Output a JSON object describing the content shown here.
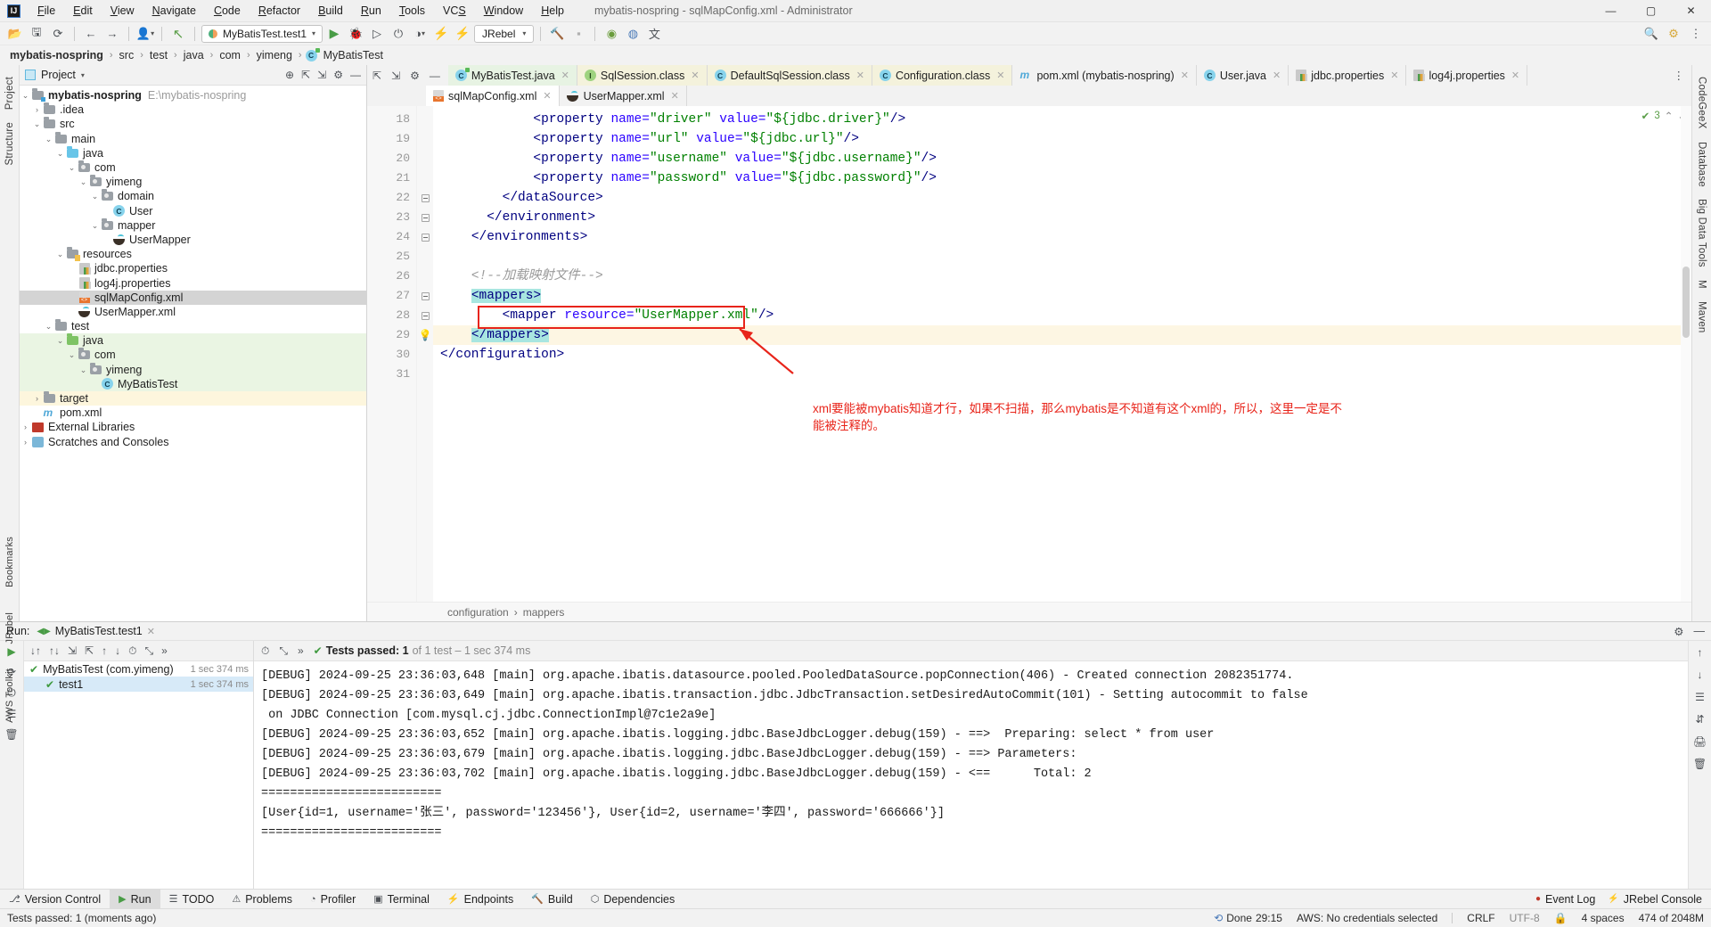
{
  "window": {
    "title": "mybatis-nospring - sqlMapConfig.xml - Administrator",
    "logo": "IJ",
    "minimize": "—",
    "maximize": "▢",
    "close": "✕"
  },
  "menubar": {
    "items": [
      "File",
      "Edit",
      "View",
      "Navigate",
      "Code",
      "Refactor",
      "Build",
      "Run",
      "Tools",
      "VCS",
      "Window",
      "Help"
    ]
  },
  "toolbar": {
    "open_icon": "📂",
    "save_icon": "🖫",
    "sync_icon": "⟳",
    "back_icon": "←",
    "forward_icon": "→",
    "profile_icon": "👤",
    "update_icon": "↖",
    "run_config": "MyBatisTest.test1",
    "run_icon": "▶",
    "debug_icon": "🐞",
    "coverage_icon": "▷",
    "profiler_icon": "◑",
    "stop_icon": "⏻",
    "jrebel_run_icon": "⚡",
    "jrebel_debug_icon": "⚡",
    "jrebel_label": "JRebel",
    "search_icon": "🔍",
    "settings_icon": "⚙",
    "more_icon": "⋮"
  },
  "breadcrumb": {
    "items": [
      "mybatis-nospring",
      "src",
      "test",
      "java",
      "com",
      "yimeng",
      "MyBatisTest"
    ],
    "separator": "›"
  },
  "left_rail": [
    "Project",
    "Structure"
  ],
  "right_rail": [
    "CodeGeeX",
    "Database",
    "Big Data Tools",
    "M",
    "Maven"
  ],
  "project_panel": {
    "title": "Project",
    "chevron": "▾",
    "locate_icon": "⊕",
    "collapse_icon": "⇲",
    "expand_icon": "⇱",
    "settings_icon": "⚙",
    "hide_icon": "—",
    "tree": [
      {
        "depth": 0,
        "arrow": "⌄",
        "icon": "folder-badge",
        "label": "mybatis-nospring",
        "bold": true,
        "path": "E:\\mybatis-nospring",
        "state": "normal"
      },
      {
        "depth": 1,
        "arrow": "›",
        "icon": "folder",
        "label": ".idea",
        "state": "normal"
      },
      {
        "depth": 1,
        "arrow": "⌄",
        "icon": "folder",
        "label": "src",
        "state": "normal"
      },
      {
        "depth": 2,
        "arrow": "⌄",
        "icon": "folder",
        "label": "main",
        "state": "normal"
      },
      {
        "depth": 3,
        "arrow": "⌄",
        "icon": "folder-blue",
        "label": "java",
        "state": "normal"
      },
      {
        "depth": 4,
        "arrow": "⌄",
        "icon": "folder-pkg",
        "label": "com",
        "state": "normal"
      },
      {
        "depth": 5,
        "arrow": "⌄",
        "icon": "folder-pkg",
        "label": "yimeng",
        "state": "normal"
      },
      {
        "depth": 6,
        "arrow": "⌄",
        "icon": "folder-pkg",
        "label": "domain",
        "state": "normal"
      },
      {
        "depth": 7,
        "arrow": "",
        "icon": "class",
        "label": "User",
        "state": "normal"
      },
      {
        "depth": 6,
        "arrow": "⌄",
        "icon": "folder-pkg",
        "label": "mapper",
        "state": "normal"
      },
      {
        "depth": 7,
        "arrow": "",
        "icon": "mapper",
        "label": "UserMapper",
        "state": "normal"
      },
      {
        "depth": 3,
        "arrow": "⌄",
        "icon": "folder-res",
        "label": "resources",
        "state": "normal"
      },
      {
        "depth": 4,
        "arrow": "",
        "icon": "properties",
        "label": "jdbc.properties",
        "state": "normal"
      },
      {
        "depth": 4,
        "arrow": "",
        "icon": "properties",
        "label": "log4j.properties",
        "state": "normal"
      },
      {
        "depth": 4,
        "arrow": "",
        "icon": "xml",
        "label": "sqlMapConfig.xml",
        "state": "selected"
      },
      {
        "depth": 4,
        "arrow": "",
        "icon": "mapper",
        "label": "UserMapper.xml",
        "state": "normal"
      },
      {
        "depth": 2,
        "arrow": "⌄",
        "icon": "folder",
        "label": "test",
        "state": "normal"
      },
      {
        "depth": 3,
        "arrow": "⌄",
        "icon": "folder-green",
        "label": "java",
        "state": "testsrc"
      },
      {
        "depth": 4,
        "arrow": "⌄",
        "icon": "folder-pkg",
        "label": "com",
        "state": "testsrc"
      },
      {
        "depth": 5,
        "arrow": "⌄",
        "icon": "folder-pkg",
        "label": "yimeng",
        "state": "testsrc"
      },
      {
        "depth": 6,
        "arrow": "",
        "icon": "class",
        "label": "MyBatisTest",
        "state": "testsrc"
      },
      {
        "depth": 1,
        "arrow": "›",
        "icon": "folder",
        "label": "target",
        "state": "target"
      },
      {
        "depth": 1,
        "arrow": "",
        "icon": "maven",
        "label": "pom.xml",
        "state": "normal"
      },
      {
        "depth": 0,
        "arrow": "›",
        "icon": "library",
        "label": "External Libraries",
        "state": "normal"
      },
      {
        "depth": 0,
        "arrow": "›",
        "icon": "scratch",
        "label": "Scratches and Consoles",
        "state": "normal"
      }
    ]
  },
  "editor": {
    "tabs_row1": [
      {
        "label": "MyBatisTest.java",
        "icon": "java-class",
        "bg": "green",
        "close": "✕"
      },
      {
        "label": "SqlSession.class",
        "icon": "interface",
        "bg": "yellow",
        "close": "✕"
      },
      {
        "label": "DefaultSqlSession.class",
        "icon": "class",
        "bg": "yellow",
        "close": "✕"
      },
      {
        "label": "Configuration.class",
        "icon": "class",
        "bg": "yellow",
        "close": "✕"
      },
      {
        "label": "pom.xml (mybatis-nospring)",
        "icon": "maven",
        "bg": "plain",
        "close": "✕"
      },
      {
        "label": "User.java",
        "icon": "class",
        "bg": "plain",
        "close": "✕"
      },
      {
        "label": "jdbc.properties",
        "icon": "properties",
        "bg": "plain",
        "close": "✕"
      },
      {
        "label": "log4j.properties",
        "icon": "properties",
        "bg": "plain",
        "close": "✕"
      }
    ],
    "tabs_row2": [
      {
        "label": "sqlMapConfig.xml",
        "icon": "xml",
        "bg": "white",
        "close": "✕"
      },
      {
        "label": "UserMapper.xml",
        "icon": "mapper",
        "bg": "plain",
        "close": "✕"
      }
    ],
    "more_tabs_icon": "⋮",
    "inspection": {
      "icon": "✔",
      "count": "3",
      "up": "⌃",
      "down": "⌄"
    },
    "lines": [
      {
        "num": "18",
        "fold": "",
        "indent": 0,
        "html": "            <span class='tag'>&lt;property</span> <span class='attr'>name=</span><span class='val'>\"driver\"</span> <span class='attr'>value=</span><span class='val'>\"${jdbc.driver}\"</span><span class='tag'>/&gt;</span>"
      },
      {
        "num": "19",
        "fold": "",
        "indent": 0,
        "html": "            <span class='tag'>&lt;property</span> <span class='attr'>name=</span><span class='val'>\"url\"</span> <span class='attr'>value=</span><span class='val'>\"${jdbc.url}\"</span><span class='tag'>/&gt;</span>"
      },
      {
        "num": "20",
        "fold": "",
        "indent": 0,
        "html": "            <span class='tag'>&lt;property</span> <span class='attr'>name=</span><span class='val'>\"username\"</span> <span class='attr'>value=</span><span class='val'>\"${jdbc.username}\"</span><span class='tag'>/&gt;</span>"
      },
      {
        "num": "21",
        "fold": "",
        "indent": 0,
        "html": "            <span class='tag'>&lt;property</span> <span class='attr'>name=</span><span class='val'>\"password\"</span> <span class='attr'>value=</span><span class='val'>\"${jdbc.password}\"</span><span class='tag'>/&gt;</span>"
      },
      {
        "num": "22",
        "fold": "fold",
        "indent": 0,
        "html": "        <span class='tag'>&lt;/dataSource&gt;</span>"
      },
      {
        "num": "23",
        "fold": "fold",
        "indent": 0,
        "html": "      <span class='tag'>&lt;/environment&gt;</span>"
      },
      {
        "num": "24",
        "fold": "fold",
        "indent": 0,
        "html": "    <span class='tag'>&lt;/environments&gt;</span>"
      },
      {
        "num": "25",
        "fold": "",
        "indent": 0,
        "html": ""
      },
      {
        "num": "26",
        "fold": "",
        "indent": 0,
        "html": "    <span class='cmt'>&lt;!--加载映射文件--&gt;</span>"
      },
      {
        "num": "27",
        "fold": "fold",
        "indent": 0,
        "html": "    <span class='tag sel'>&lt;mappers&gt;</span>"
      },
      {
        "num": "28",
        "fold": "fold",
        "indent": 0,
        "html": "        <span class='tag'>&lt;mapper</span> <span class='attr'>resource=</span><span class='val'>\"UserMapper.xml\"</span><span class='tag'>/&gt;</span>"
      },
      {
        "num": "29",
        "fold": "bulb",
        "indent": 0,
        "html": "    <span class='tag sel'>&lt;/mappers&gt;</span>",
        "highlight": true
      },
      {
        "num": "30",
        "fold": "",
        "indent": 0,
        "html": "<span class='tag'>&lt;/configuration&gt;</span>"
      },
      {
        "num": "31",
        "fold": "",
        "indent": 0,
        "html": ""
      }
    ],
    "annotation": "xml要能被mybatis知道才行，如果不扫描，那么mybatis是不知道有这个xml的，所以，这里一定是不能被注释的。",
    "status_breadcrumb": [
      "configuration",
      "mappers"
    ],
    "status_breadcrumb_sep": "›"
  },
  "run_panel": {
    "label": "Run:",
    "config_name": "MyBatisTest.test1",
    "config_icon": "◀▶",
    "close_icon": "✕",
    "settings_icon": "⚙",
    "hide_icon": "—",
    "left_actions": [
      "▶",
      "⟳",
      "⏻",
      "☰",
      "🗑"
    ],
    "tree_toolbar": [
      "↓↑",
      "↑↓",
      "⇲",
      "⇱",
      "↑",
      "↓",
      "⏱",
      "⤡",
      "»"
    ],
    "status_check": "✔",
    "status_main": "Tests passed: 1",
    "status_rest": "of 1 test – 1 sec 374 ms",
    "tests": [
      {
        "icon": "✔",
        "label": "MyBatisTest (com.yimeng)",
        "duration": "1 sec 374 ms",
        "selected": false
      },
      {
        "icon": "✔",
        "label": "test1",
        "duration": "1 sec 374 ms",
        "selected": true
      }
    ],
    "console": [
      "[DEBUG] 2024-09-25 23:36:03,648 [main] org.apache.ibatis.datasource.pooled.PooledDataSource.popConnection(406) - Created connection 2082351774.",
      "[DEBUG] 2024-09-25 23:36:03,649 [main] org.apache.ibatis.transaction.jdbc.JdbcTransaction.setDesiredAutoCommit(101) - Setting autocommit to false",
      " on JDBC Connection [com.mysql.cj.jdbc.ConnectionImpl@7c1e2a9e]",
      "[DEBUG] 2024-09-25 23:36:03,652 [main] org.apache.ibatis.logging.jdbc.BaseJdbcLogger.debug(159) - ==>  Preparing: select * from user",
      "[DEBUG] 2024-09-25 23:36:03,679 [main] org.apache.ibatis.logging.jdbc.BaseJdbcLogger.debug(159) - ==> Parameters:",
      "[DEBUG] 2024-09-25 23:36:03,702 [main] org.apache.ibatis.logging.jdbc.BaseJdbcLogger.debug(159) - <==      Total: 2",
      "=========================",
      "[User{id=1, username='张三', password='123456'}, User{id=2, username='李四', password='666666'}]",
      "========================="
    ],
    "right_actions": [
      "↑",
      "↓",
      "☰",
      "⇵",
      "🖨",
      "🗑"
    ]
  },
  "tool_window_bar": {
    "items": [
      {
        "label": "Version Control",
        "icon": "⎇",
        "active": false
      },
      {
        "label": "Run",
        "icon": "▶",
        "active": true
      },
      {
        "label": "TODO",
        "icon": "☰",
        "active": false
      },
      {
        "label": "Problems",
        "icon": "⚠",
        "active": false
      },
      {
        "label": "Profiler",
        "icon": "◔",
        "active": false
      },
      {
        "label": "Terminal",
        "icon": "▣",
        "active": false
      },
      {
        "label": "Endpoints",
        "icon": "⚡",
        "active": false
      },
      {
        "label": "Build",
        "icon": "🔨",
        "active": false
      },
      {
        "label": "Dependencies",
        "icon": "⬡",
        "active": false
      }
    ],
    "right": [
      {
        "label": "Event Log",
        "icon": "●"
      },
      {
        "label": "JRebel Console",
        "icon": "⚡"
      }
    ]
  },
  "status_bar": {
    "message": "Tests passed: 1 (moments ago)",
    "done_icon": "⟲",
    "done_text": "Done",
    "done_time": "29:15",
    "aws": "AWS: No credentials selected",
    "line_sep": "CRLF",
    "encoding": "UTF-8",
    "indent": "4 spaces",
    "memory": "474 of 2048M",
    "lock_icon": "🔒"
  },
  "left_vbar": [
    "Bookmarks",
    "JRebel",
    "AWS Toolkit"
  ],
  "colors": {
    "accent": "#3b78c4",
    "annotation_red": "#e8241a",
    "selection_teal": "#a8e6e0",
    "test_src_green": "#eaf5e3",
    "target_yellow": "#fdf6dd"
  }
}
